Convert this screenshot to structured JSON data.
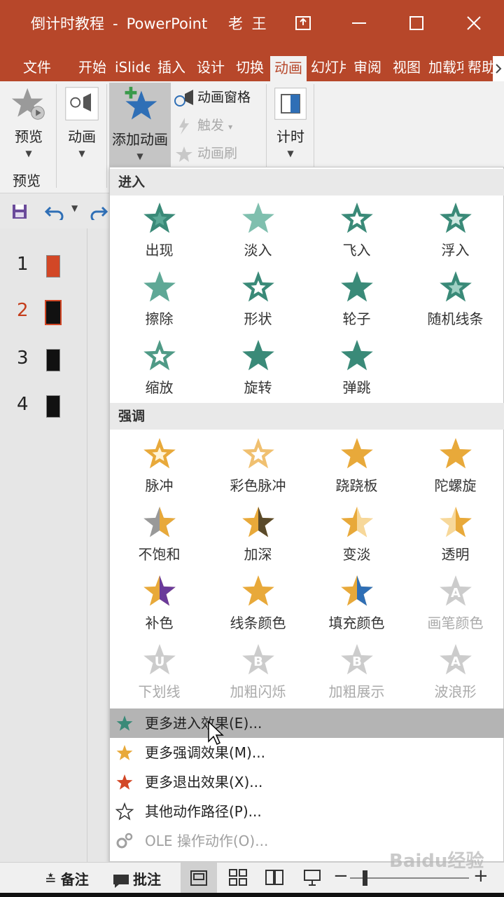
{
  "window": {
    "doc_title": "倒计时教程",
    "separator": "-",
    "app_name": "PowerPoint",
    "user_name": "老 王"
  },
  "tabs": [
    {
      "label": "文件"
    },
    {
      "label": "开始"
    },
    {
      "label": "iSlide"
    },
    {
      "label": "插入"
    },
    {
      "label": "设计"
    },
    {
      "label": "切换"
    },
    {
      "label": "动画",
      "active": true
    },
    {
      "label": "幻灯片放映"
    },
    {
      "label": "审阅"
    },
    {
      "label": "视图"
    },
    {
      "label": "加载项"
    },
    {
      "label": "帮助"
    }
  ],
  "ribbon": {
    "preview_label": "预览",
    "preview_group_label": "预览",
    "animation_label": "动画",
    "add_animation_label": "添加动画",
    "animation_pane_label": "动画窗格",
    "trigger_label": "触发",
    "animation_painter_label": "动画刷",
    "timing_label": "计时"
  },
  "slides": [
    {
      "num": "1"
    },
    {
      "num": "2",
      "selected": true
    },
    {
      "num": "3"
    },
    {
      "num": "4"
    }
  ],
  "gallery": {
    "entrance_header": "进入",
    "emphasis_header": "强调",
    "entrance": [
      {
        "label": "出现",
        "icon": "appear-icon"
      },
      {
        "label": "淡入",
        "icon": "fade-icon"
      },
      {
        "label": "飞入",
        "icon": "fly-in-icon"
      },
      {
        "label": "浮入",
        "icon": "float-in-icon"
      },
      {
        "label": "擦除",
        "icon": "wipe-icon"
      },
      {
        "label": "形状",
        "icon": "shape-icon"
      },
      {
        "label": "轮子",
        "icon": "wheel-icon"
      },
      {
        "label": "随机线条",
        "icon": "random-bars-icon"
      },
      {
        "label": "缩放",
        "icon": "zoom-icon"
      },
      {
        "label": "旋转",
        "icon": "swivel-icon"
      },
      {
        "label": "弹跳",
        "icon": "bounce-icon"
      }
    ],
    "emphasis": [
      {
        "label": "脉冲",
        "icon": "pulse-icon"
      },
      {
        "label": "彩色脉冲",
        "icon": "color-pulse-icon"
      },
      {
        "label": "跷跷板",
        "icon": "teeter-icon"
      },
      {
        "label": "陀螺旋",
        "icon": "spin-icon"
      },
      {
        "label": "不饱和",
        "icon": "desaturate-icon"
      },
      {
        "label": "加深",
        "icon": "darken-icon"
      },
      {
        "label": "变淡",
        "icon": "lighten-icon"
      },
      {
        "label": "透明",
        "icon": "transparency-icon"
      },
      {
        "label": "补色",
        "icon": "complementary-color-icon"
      },
      {
        "label": "线条颜色",
        "icon": "line-color-icon"
      },
      {
        "label": "填充颜色",
        "icon": "fill-color-icon"
      },
      {
        "label": "画笔颜色",
        "icon": "brush-color-icon",
        "disabled": true
      },
      {
        "label": "下划线",
        "icon": "underline-icon",
        "disabled": true
      },
      {
        "label": "加粗闪烁",
        "icon": "bold-flash-icon",
        "disabled": true
      },
      {
        "label": "加粗展示",
        "icon": "bold-reveal-icon",
        "disabled": true
      },
      {
        "label": "波浪形",
        "icon": "wave-icon",
        "disabled": true
      }
    ],
    "more": [
      {
        "label": "更多进入效果(E)...",
        "icon": "green-star-icon",
        "highlighted": true
      },
      {
        "label": "更多强调效果(M)...",
        "icon": "gold-star-icon"
      },
      {
        "label": "更多退出效果(X)...",
        "icon": "red-star-icon"
      },
      {
        "label": "其他动作路径(P)...",
        "icon": "outline-star-icon"
      },
      {
        "label": "OLE 操作动作(O)...",
        "icon": "gears-icon",
        "disabled": true
      }
    ]
  },
  "statusbar": {
    "notes_label": "备注",
    "comments_label": "批注"
  },
  "watermark": "Baidu经验",
  "colors": {
    "accent": "#b7472a",
    "entrance_green": "#3a8a78",
    "emphasis_gold": "#e8a93a",
    "exit_red": "#d24726"
  }
}
